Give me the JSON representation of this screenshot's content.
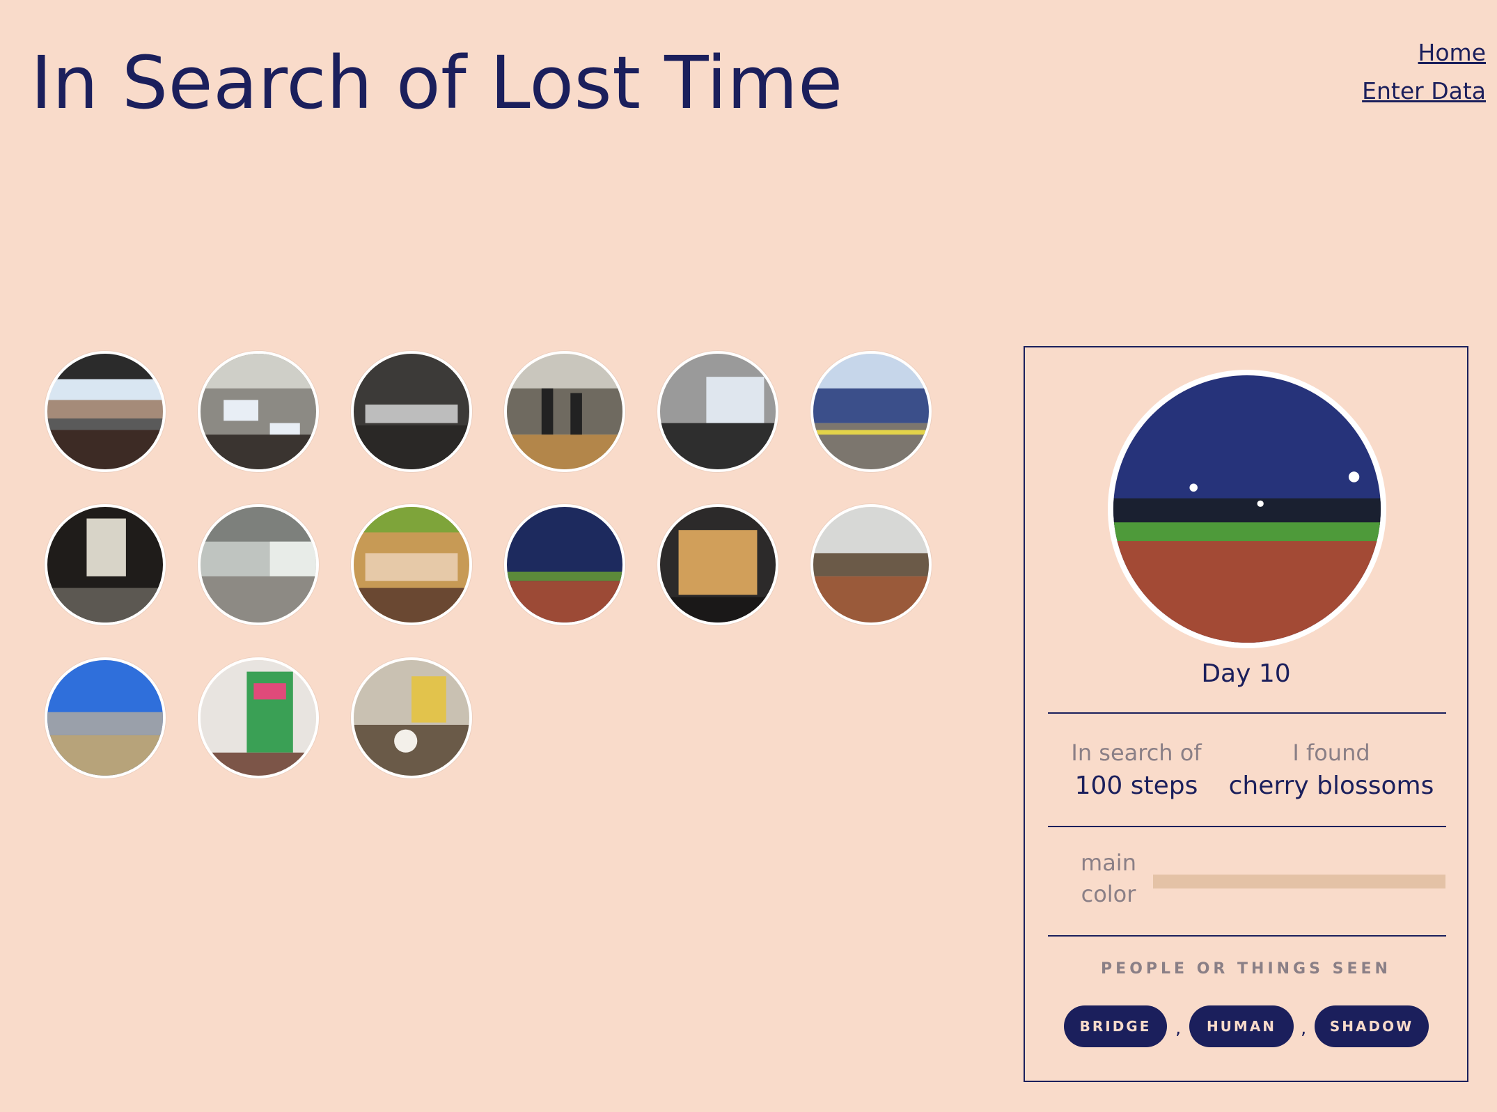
{
  "header": {
    "title": "In Search of Lost Time"
  },
  "nav": {
    "home": "Home",
    "enter_data": "Enter Data"
  },
  "thumbnails": [
    {
      "name": "thumb-elevated-train-view"
    },
    {
      "name": "thumb-office-desks"
    },
    {
      "name": "thumb-car-interior"
    },
    {
      "name": "thumb-office-people"
    },
    {
      "name": "thumb-window-lounge"
    },
    {
      "name": "thumb-street-ice-cream"
    },
    {
      "name": "thumb-window-room"
    },
    {
      "name": "thumb-subway-station"
    },
    {
      "name": "thumb-restaurant"
    },
    {
      "name": "thumb-night-track"
    },
    {
      "name": "thumb-shop-window"
    },
    {
      "name": "thumb-kitchen-counter"
    },
    {
      "name": "thumb-train-platform"
    },
    {
      "name": "thumb-grocery-store"
    },
    {
      "name": "thumb-dining-table"
    }
  ],
  "detail": {
    "day": "Day 10",
    "in_search_of_label": "In search of",
    "in_search_of_value": "100 steps",
    "found_label": "I found",
    "found_value": "cherry blossoms",
    "main_color_label_1": "main",
    "main_color_label_2": "color",
    "main_color": "#e4c2a6",
    "seen_label": "PEOPLE OR THINGS SEEN",
    "tags": [
      "BRIDGE",
      "HUMAN",
      "SHADOW"
    ],
    "separator": ","
  }
}
